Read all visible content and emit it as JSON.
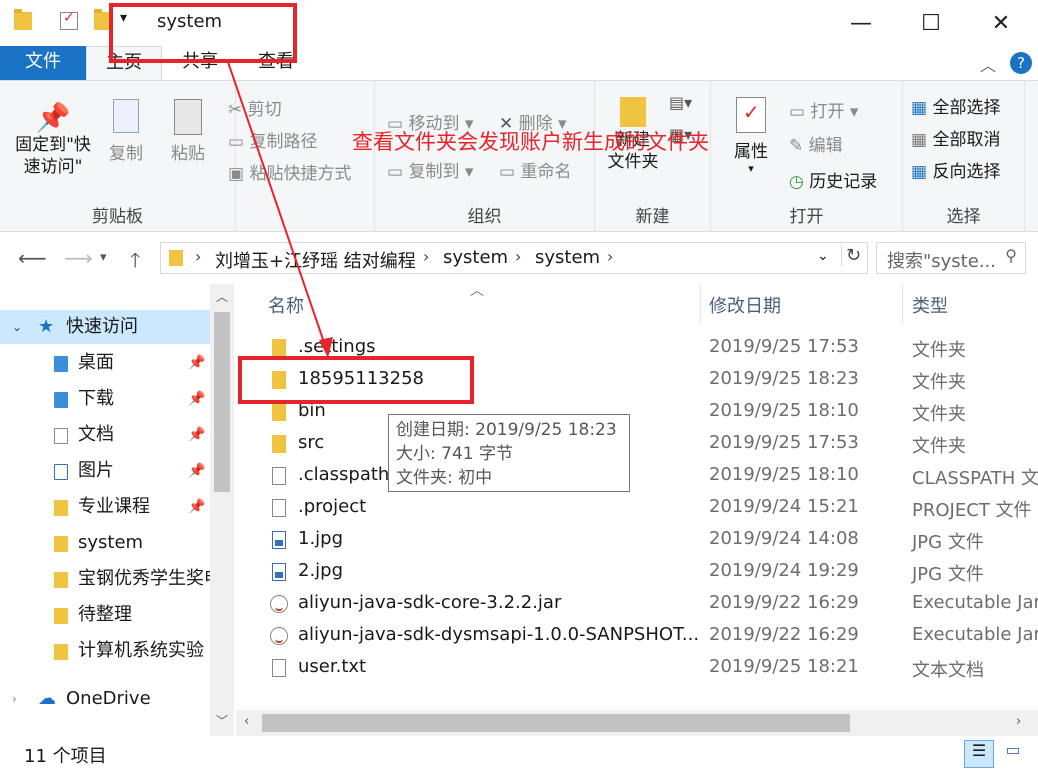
{
  "window": {
    "title": "system",
    "minimize_glyph": "—",
    "maximize_glyph": "☐",
    "close_glyph": "✕"
  },
  "ribbon_tabs": {
    "file": "文件",
    "home": "主页",
    "share": "共享",
    "view": "查看"
  },
  "ribbon": {
    "clipboard": {
      "label": "剪贴板",
      "pin": "固定到\"快\n速访问\"",
      "copy": "复制",
      "paste": "粘贴",
      "cut": "剪切",
      "copy_path": "复制路径",
      "paste_shortcut": "粘贴快捷方式"
    },
    "organize": {
      "label": "组织",
      "move_to": "移动到",
      "copy_to": "复制到",
      "delete": "删除",
      "rename": "重命名"
    },
    "new": {
      "label": "新建",
      "new_folder": "新建\n文件夹"
    },
    "open": {
      "label": "打开",
      "properties": "属性",
      "open": "打开",
      "edit": "编辑",
      "history": "历史记录"
    },
    "select": {
      "label": "选择",
      "select_all": "全部选择",
      "select_none": "全部取消",
      "invert": "反向选择"
    }
  },
  "address": {
    "breadcrumbs": [
      "刘增玉+江纾瑶 结对编程",
      "system",
      "system"
    ],
    "search_placeholder": "搜索\"syste..."
  },
  "nav_pane": {
    "quick_access": "快速访问",
    "items": [
      {
        "label": "桌面",
        "pinned": true
      },
      {
        "label": "下载",
        "pinned": true
      },
      {
        "label": "文档",
        "pinned": true
      },
      {
        "label": "图片",
        "pinned": true
      },
      {
        "label": "专业课程",
        "pinned": true
      },
      {
        "label": "system",
        "pinned": false
      },
      {
        "label": "宝钢优秀学生奖申",
        "pinned": false
      },
      {
        "label": "待整理",
        "pinned": false
      },
      {
        "label": "计算机系统实验",
        "pinned": false
      }
    ],
    "onedrive": "OneDrive"
  },
  "file_list": {
    "columns": {
      "name": "名称",
      "date": "修改日期",
      "type": "类型"
    },
    "rows": [
      {
        "name": ".settings",
        "date": "2019/9/25 17:53",
        "type": "文件夹",
        "icon": "folder"
      },
      {
        "name": "18595113258",
        "date": "2019/9/25 18:23",
        "type": "文件夹",
        "icon": "folder"
      },
      {
        "name": "bin",
        "date": "2019/9/25 18:10",
        "type": "文件夹",
        "icon": "folder"
      },
      {
        "name": "src",
        "date": "2019/9/25 17:53",
        "type": "文件夹",
        "icon": "folder"
      },
      {
        "name": ".classpath",
        "date": "2019/9/25 18:10",
        "type": "CLASSPATH 文",
        "icon": "doc"
      },
      {
        "name": ".project",
        "date": "2019/9/24 15:21",
        "type": "PROJECT 文件",
        "icon": "doc"
      },
      {
        "name": "1.jpg",
        "date": "2019/9/24 14:08",
        "type": "JPG 文件",
        "icon": "img"
      },
      {
        "name": "2.jpg",
        "date": "2019/9/24 19:29",
        "type": "JPG 文件",
        "icon": "img"
      },
      {
        "name": "aliyun-java-sdk-core-3.2.2.jar",
        "date": "2019/9/22 16:29",
        "type": "Executable Jar",
        "icon": "jar"
      },
      {
        "name": "aliyun-java-sdk-dysmsapi-1.0.0-SANPSHOT...",
        "date": "2019/9/22 16:29",
        "type": "Executable Jar",
        "icon": "jar"
      },
      {
        "name": "user.txt",
        "date": "2019/9/25 18:21",
        "type": "文本文档",
        "icon": "doc"
      }
    ]
  },
  "tooltip": {
    "created": "创建日期: 2019/9/25 18:23",
    "size": "大小: 741 字节",
    "folder": "文件夹: 初中"
  },
  "status": {
    "item_count": "11 个项目"
  },
  "annotation": {
    "text": "查看文件夹会发现账户新生成的文件夹",
    "color": "#e8242b"
  }
}
